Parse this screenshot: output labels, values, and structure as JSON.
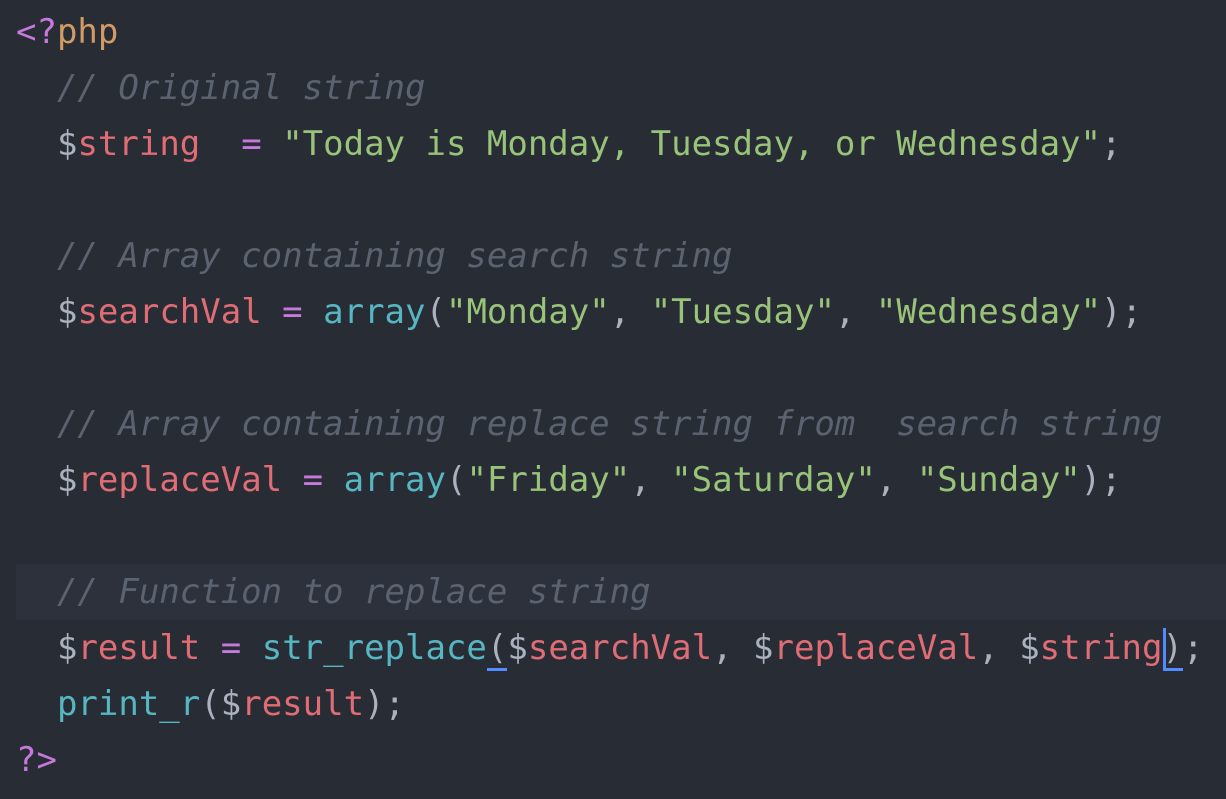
{
  "editor": {
    "language": "php",
    "theme_colors": {
      "background": "#282c34",
      "active_line": "#2c313c",
      "tag": "#c678dd",
      "keyword_php": "#d19a66",
      "comment": "#5c6370",
      "variable": "#e06c75",
      "operator": "#c678dd",
      "string": "#98c379",
      "function": "#56b6c2",
      "punctuation": "#abb2bf",
      "bracket_match": "#528bff"
    },
    "active_line_index": 10,
    "lines": [
      {
        "tokens": [
          {
            "t": "tag",
            "v": "<?"
          },
          {
            "t": "php",
            "v": "php"
          }
        ]
      },
      {
        "tokens": [
          {
            "t": "punc",
            "v": "  "
          },
          {
            "t": "comment",
            "v": "// Original string"
          }
        ]
      },
      {
        "tokens": [
          {
            "t": "punc",
            "v": "  "
          },
          {
            "t": "dollar",
            "v": "$"
          },
          {
            "t": "var",
            "v": "string"
          },
          {
            "t": "punc",
            "v": "  "
          },
          {
            "t": "op",
            "v": "="
          },
          {
            "t": "punc",
            "v": " "
          },
          {
            "t": "str",
            "v": "\"Today is Monday, Tuesday, or Wednesday\""
          },
          {
            "t": "punc",
            "v": ";"
          }
        ]
      },
      {
        "tokens": []
      },
      {
        "tokens": [
          {
            "t": "punc",
            "v": "  "
          },
          {
            "t": "comment",
            "v": "// Array containing search string"
          }
        ]
      },
      {
        "tokens": [
          {
            "t": "punc",
            "v": "  "
          },
          {
            "t": "dollar",
            "v": "$"
          },
          {
            "t": "var",
            "v": "searchVal"
          },
          {
            "t": "punc",
            "v": " "
          },
          {
            "t": "op",
            "v": "="
          },
          {
            "t": "punc",
            "v": " "
          },
          {
            "t": "fn",
            "v": "array"
          },
          {
            "t": "punc",
            "v": "("
          },
          {
            "t": "str",
            "v": "\"Monday\""
          },
          {
            "t": "punc",
            "v": ", "
          },
          {
            "t": "str",
            "v": "\"Tuesday\""
          },
          {
            "t": "punc",
            "v": ", "
          },
          {
            "t": "str",
            "v": "\"Wednesday\""
          },
          {
            "t": "punc",
            "v": ");"
          }
        ]
      },
      {
        "tokens": []
      },
      {
        "tokens": [
          {
            "t": "punc",
            "v": "  "
          },
          {
            "t": "comment",
            "v": "// Array containing replace string from  search string"
          }
        ]
      },
      {
        "tokens": [
          {
            "t": "punc",
            "v": "  "
          },
          {
            "t": "dollar",
            "v": "$"
          },
          {
            "t": "var",
            "v": "replaceVal"
          },
          {
            "t": "punc",
            "v": " "
          },
          {
            "t": "op",
            "v": "="
          },
          {
            "t": "punc",
            "v": " "
          },
          {
            "t": "fn",
            "v": "array"
          },
          {
            "t": "punc",
            "v": "("
          },
          {
            "t": "str",
            "v": "\"Friday\""
          },
          {
            "t": "punc",
            "v": ", "
          },
          {
            "t": "str",
            "v": "\"Saturday\""
          },
          {
            "t": "punc",
            "v": ", "
          },
          {
            "t": "str",
            "v": "\"Sunday\""
          },
          {
            "t": "punc",
            "v": ");"
          }
        ]
      },
      {
        "tokens": []
      },
      {
        "tokens": [
          {
            "t": "punc",
            "v": "  "
          },
          {
            "t": "comment",
            "v": "// Function to replace string"
          }
        ]
      },
      {
        "tokens": [
          {
            "t": "punc",
            "v": "  "
          },
          {
            "t": "dollar",
            "v": "$"
          },
          {
            "t": "var",
            "v": "result"
          },
          {
            "t": "punc",
            "v": " "
          },
          {
            "t": "op",
            "v": "="
          },
          {
            "t": "punc",
            "v": " "
          },
          {
            "t": "fn",
            "v": "str_replace"
          },
          {
            "t": "punc",
            "v": "(",
            "match": true
          },
          {
            "t": "dollar",
            "v": "$"
          },
          {
            "t": "var",
            "v": "searchVal"
          },
          {
            "t": "punc",
            "v": ", "
          },
          {
            "t": "dollar",
            "v": "$"
          },
          {
            "t": "var",
            "v": "replaceVal"
          },
          {
            "t": "punc",
            "v": ", "
          },
          {
            "t": "dollar",
            "v": "$"
          },
          {
            "t": "var",
            "v": "string"
          },
          {
            "t": "cursor",
            "v": ""
          },
          {
            "t": "punc",
            "v": ")",
            "match": true
          },
          {
            "t": "punc",
            "v": ";"
          }
        ]
      },
      {
        "tokens": [
          {
            "t": "punc",
            "v": "  "
          },
          {
            "t": "fn",
            "v": "print_r"
          },
          {
            "t": "punc",
            "v": "("
          },
          {
            "t": "dollar",
            "v": "$"
          },
          {
            "t": "var",
            "v": "result"
          },
          {
            "t": "punc",
            "v": ");"
          }
        ]
      },
      {
        "tokens": [
          {
            "t": "tag",
            "v": "?>"
          }
        ]
      }
    ]
  }
}
